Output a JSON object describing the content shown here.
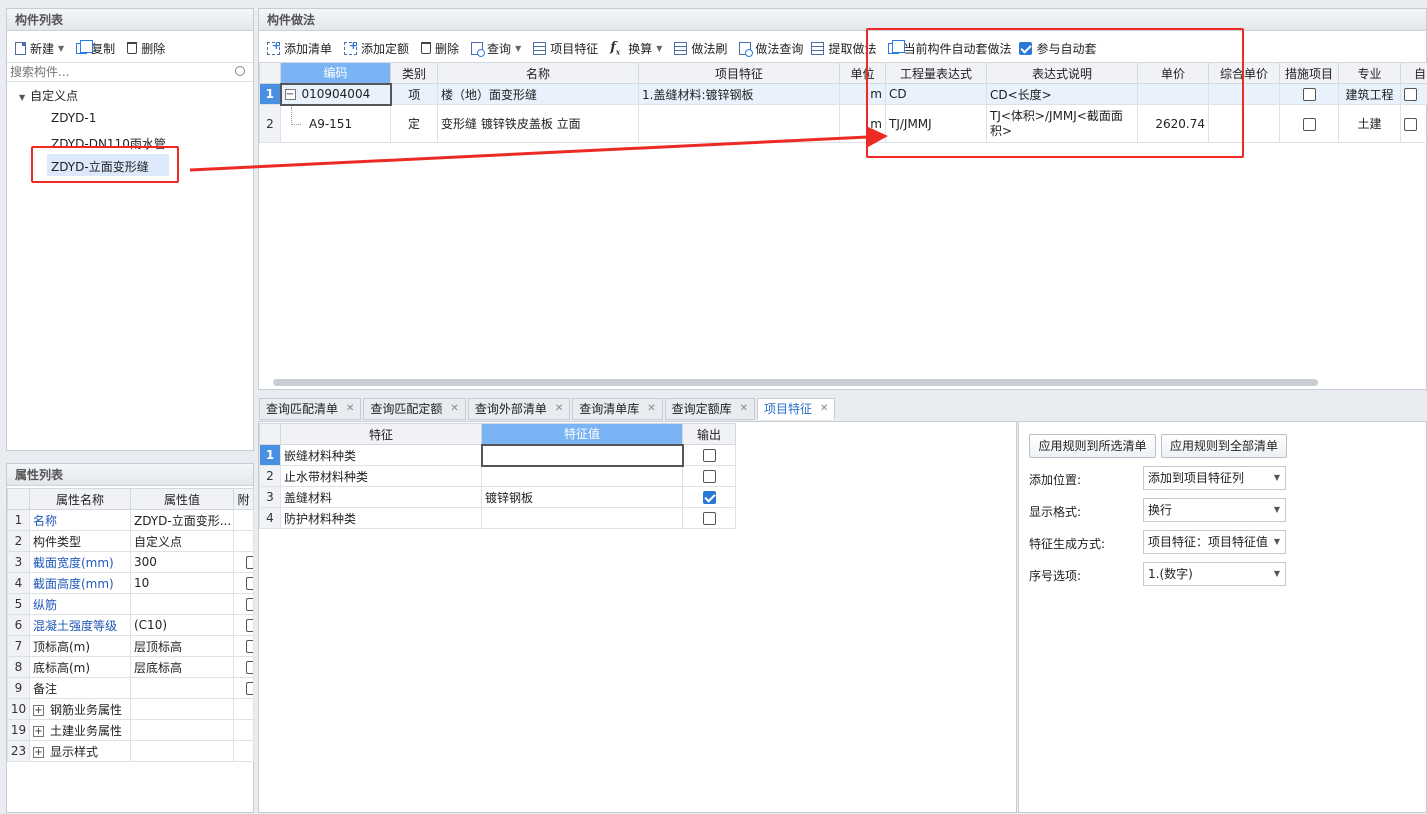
{
  "left_top": {
    "title": "构件列表",
    "toolbar": {
      "new_label": "新建",
      "copy_label": "复制",
      "delete_label": "删除"
    },
    "search_placeholder": "搜索构件...",
    "tree": {
      "root": "自定义点",
      "items": [
        "ZDYD-1",
        "ZDYD-DN110雨水管",
        "ZDYD-立面变形缝"
      ]
    }
  },
  "props": {
    "title": "属性列表",
    "headers": [
      "属性名称",
      "属性值",
      "附"
    ],
    "rows": [
      {
        "n": "1",
        "name": "名称",
        "value": "ZDYD-立面变形...",
        "link": true,
        "cb": false
      },
      {
        "n": "2",
        "name": "构件类型",
        "value": "自定义点",
        "link": false,
        "cb": false
      },
      {
        "n": "3",
        "name": "截面宽度(mm)",
        "value": "300",
        "link": true,
        "cb": true
      },
      {
        "n": "4",
        "name": "截面高度(mm)",
        "value": "10",
        "link": true,
        "cb": true
      },
      {
        "n": "5",
        "name": "纵筋",
        "value": "",
        "link": true,
        "cb": true
      },
      {
        "n": "6",
        "name": "混凝土强度等级",
        "value": "(C10)",
        "link": true,
        "cb": true
      },
      {
        "n": "7",
        "name": "顶标高(m)",
        "value": "层顶标高",
        "link": false,
        "cb": true
      },
      {
        "n": "8",
        "name": "底标高(m)",
        "value": "层底标高",
        "link": false,
        "cb": true
      },
      {
        "n": "9",
        "name": "备注",
        "value": "",
        "link": false,
        "cb": true
      },
      {
        "n": "10",
        "name": "钢筋业务属性",
        "value": "",
        "link": false,
        "cb": false,
        "exp": true
      },
      {
        "n": "19",
        "name": "土建业务属性",
        "value": "",
        "link": false,
        "cb": false,
        "exp": true
      },
      {
        "n": "23",
        "name": "显示样式",
        "value": "",
        "link": false,
        "cb": false,
        "exp": true
      }
    ]
  },
  "method": {
    "title": "构件做法",
    "toolbar": {
      "add_list": "添加清单",
      "add_quota": "添加定额",
      "delete": "删除",
      "query": "查询",
      "item_feature": "项目特征",
      "convert": "换算",
      "method_brush": "做法刷",
      "method_query": "做法查询",
      "extract": "提取做法",
      "auto_apply": "当前构件自动套做法",
      "participate": "参与自动套"
    },
    "headers": [
      "编码",
      "类别",
      "名称",
      "项目特征",
      "单位",
      "工程量表达式",
      "表达式说明",
      "单价",
      "综合单价",
      "措施项目",
      "专业",
      "自"
    ],
    "rows": [
      {
        "n": "1",
        "code": "010904004",
        "cat": "项",
        "name": "楼（地）面变形缝",
        "feature": "1.盖缝材料:镀锌钢板",
        "unit": "m",
        "expr": "CD",
        "desc": "CD<长度>",
        "price": "",
        "total": "",
        "measure": false,
        "major": "建筑工程"
      },
      {
        "n": "2",
        "code": "A9-151",
        "cat": "定",
        "name": "变形缝 镀锌铁皮盖板 立面",
        "feature": "",
        "unit": "m",
        "expr": "TJ/JMMJ",
        "desc": "TJ<体积>/JMMJ<截面面积>",
        "price": "2620.74",
        "total": "",
        "measure": false,
        "major": "土建"
      }
    ]
  },
  "bottom": {
    "tabs": [
      "查询匹配清单",
      "查询匹配定额",
      "查询外部清单",
      "查询清单库",
      "查询定额库",
      "项目特征"
    ],
    "feature_headers": [
      "特征",
      "特征值",
      "输出"
    ],
    "features": [
      {
        "n": "1",
        "name": "嵌缝材料种类",
        "value": "",
        "out": false
      },
      {
        "n": "2",
        "name": "止水带材料种类",
        "value": "",
        "out": false
      },
      {
        "n": "3",
        "name": "盖缝材料",
        "value": "镀锌钢板",
        "out": true
      },
      {
        "n": "4",
        "name": "防护材料种类",
        "value": "",
        "out": false
      }
    ],
    "apply_selected": "应用规则到所选清单",
    "apply_all": "应用规则到全部清单",
    "settings": [
      {
        "label": "添加位置:",
        "value": "添加到项目特征列"
      },
      {
        "label": "显示格式:",
        "value": "换行"
      },
      {
        "label": "特征生成方式:",
        "value": "项目特征：项目特征值"
      },
      {
        "label": "序号选项:",
        "value": "1.(数字)"
      }
    ]
  },
  "colors": {
    "annotation": "#ee2a24",
    "selection": "#4a90e2",
    "accent": "#2a78d6"
  }
}
